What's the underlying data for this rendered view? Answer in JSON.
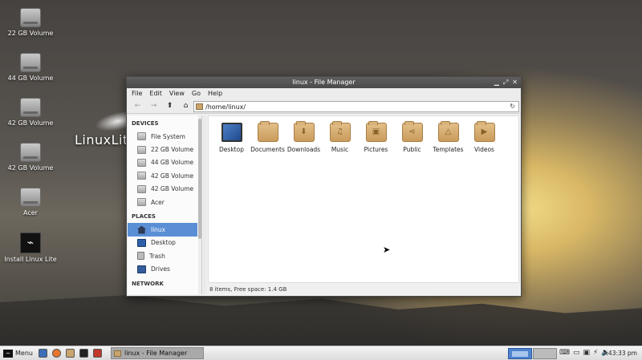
{
  "desktop": {
    "brand": "LinuxLite",
    "icons": [
      {
        "label": "22 GB Volume",
        "icon": "drive-icon"
      },
      {
        "label": "44 GB Volume",
        "icon": "drive-icon"
      },
      {
        "label": "42 GB Volume",
        "icon": "drive-icon"
      },
      {
        "label": "42 GB Volume",
        "icon": "drive-icon"
      },
      {
        "label": "Acer",
        "icon": "drive-icon"
      },
      {
        "label": "Install Linux Lite",
        "icon": "installer-icon"
      }
    ]
  },
  "window": {
    "title": "linux - File Manager",
    "controls": [
      "minimize-icon",
      "maximize-icon",
      "close-icon"
    ],
    "menu": [
      "File",
      "Edit",
      "View",
      "Go",
      "Help"
    ],
    "path": "/home/linux/",
    "sidebar": {
      "devices_heading": "DEVICES",
      "devices": [
        "File System",
        "22 GB Volume",
        "44 GB Volume",
        "42 GB Volume",
        "42 GB Volume",
        "Acer"
      ],
      "places_heading": "PLACES",
      "places": [
        "linux",
        "Desktop",
        "Trash",
        "Drives"
      ],
      "network_heading": "NETWORK",
      "selected": "linux"
    },
    "files": [
      {
        "name": "Desktop",
        "glyph": ""
      },
      {
        "name": "Documents",
        "glyph": ""
      },
      {
        "name": "Downloads",
        "glyph": "⬇"
      },
      {
        "name": "Music",
        "glyph": "♫"
      },
      {
        "name": "Pictures",
        "glyph": "▣"
      },
      {
        "name": "Public",
        "glyph": "⋖"
      },
      {
        "name": "Templates",
        "glyph": "△"
      },
      {
        "name": "Videos",
        "glyph": "▶"
      }
    ],
    "status": "8 items, Free space: 1.4 GB"
  },
  "taskbar": {
    "menu_label": "Menu",
    "task_label": "linux - File Manager",
    "clock": "4:43:33 pm",
    "accent": "#4f83cf"
  }
}
